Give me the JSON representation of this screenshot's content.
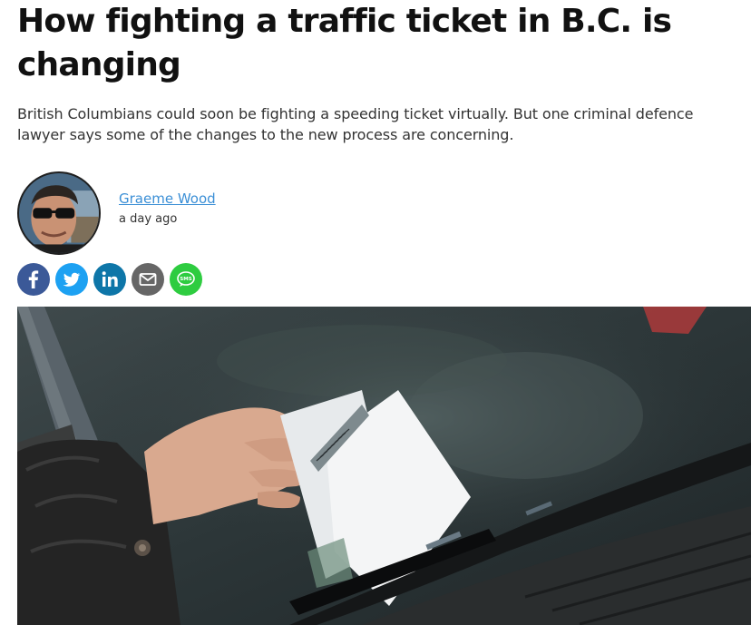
{
  "article": {
    "headline": "How fighting a traffic ticket in B.C. is changing",
    "subheadline": "British Columbians could soon be fighting a speeding ticket virtually. But one criminal defence lawyer says some of the changes to the new process are concerning.",
    "author_name": "Graeme Wood",
    "timestamp": "a day ago"
  },
  "share": {
    "buttons": [
      {
        "name": "facebook",
        "icon": "facebook-icon",
        "color": "#3b5998"
      },
      {
        "name": "twitter",
        "icon": "twitter-icon",
        "color": "#1da1f2"
      },
      {
        "name": "linkedin",
        "icon": "linkedin-icon",
        "color": "#0e76a8"
      },
      {
        "name": "email",
        "icon": "email-icon",
        "color": "#666666"
      },
      {
        "name": "sms",
        "icon": "sms-icon",
        "color": "#2ecc40",
        "label": "SMS"
      }
    ]
  },
  "colors": {
    "link": "#3b8fd6",
    "text": "#111111"
  }
}
